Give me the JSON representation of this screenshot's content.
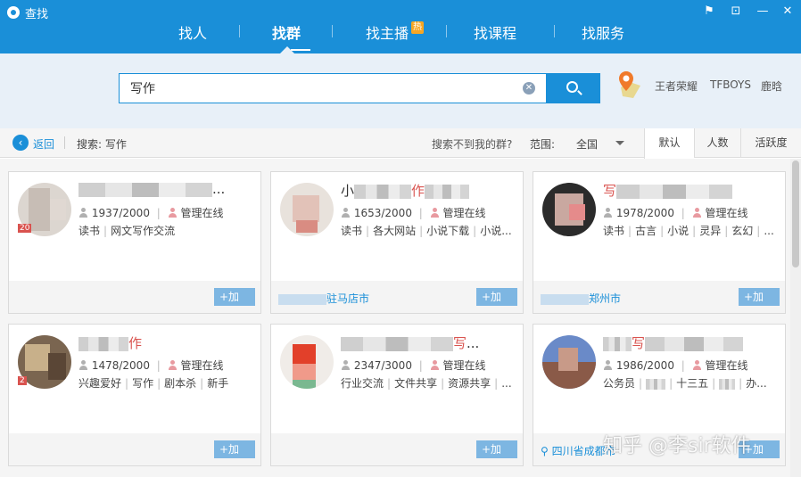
{
  "window": {
    "title": "查找",
    "controls": [
      "⚑",
      "⊡",
      "—",
      "✕"
    ]
  },
  "nav": {
    "tabs": [
      {
        "label": "找人"
      },
      {
        "label": "找群"
      },
      {
        "label": "找主播",
        "badge": "热"
      },
      {
        "label": "找课程"
      },
      {
        "label": "找服务"
      }
    ],
    "active_index": 1
  },
  "search": {
    "value": "写作",
    "placeholder": "",
    "hot_words": [
      "王者荣耀",
      "TFBOYS",
      "鹿晗"
    ]
  },
  "filter": {
    "back_label": "返回",
    "query_label": "搜索: 写作",
    "not_found": "搜索不到我的群?",
    "scope_label": "范围:",
    "scope_value": "全国",
    "sort_tabs": [
      "默认",
      "人数",
      "活跃度"
    ],
    "sort_active": 0
  },
  "results": [
    {
      "title_prefix": "",
      "title_hl": "",
      "title_suffix": "...",
      "members": "1937/2000",
      "admin": "管理在线",
      "tags": [
        "读书",
        "网文写作交流"
      ],
      "location": "",
      "badge": "20",
      "add": "+加"
    },
    {
      "title_prefix": "小",
      "title_hl": "作",
      "title_suffix": "",
      "members": "1653/2000",
      "admin": "管理在线",
      "tags": [
        "读书",
        "各大网站",
        "小说下载",
        "小说..."
      ],
      "location": "驻马店市",
      "badge": "",
      "add": "+加"
    },
    {
      "title_prefix": "",
      "title_hl": "写",
      "title_suffix": "",
      "members": "1978/2000",
      "admin": "管理在线",
      "tags": [
        "读书",
        "古言",
        "小说",
        "灵异",
        "玄幻",
        "..."
      ],
      "location": "郑州市",
      "badge": "",
      "add": "+加"
    },
    {
      "title_prefix": "",
      "title_hl": "作",
      "title_suffix": "",
      "members": "1478/2000",
      "admin": "管理在线",
      "tags": [
        "兴趣爱好",
        "写作",
        "剧本杀",
        "新手"
      ],
      "location": "",
      "badge": "2",
      "add": "+加"
    },
    {
      "title_prefix": "",
      "title_hl": "写",
      "title_suffix": "...",
      "members": "2347/3000",
      "admin": "管理在线",
      "tags": [
        "行业交流",
        "文件共享",
        "资源共享",
        "..."
      ],
      "location": "",
      "badge": "",
      "add": "+加"
    },
    {
      "title_prefix": "",
      "title_hl": "写",
      "title_suffix": "",
      "members": "1986/2000",
      "admin": "管理在线",
      "tags": [
        "公务员",
        "",
        "十三五",
        "",
        "办..."
      ],
      "location": "四川省成都市",
      "badge": "",
      "add": "+加"
    }
  ],
  "watermark": "知乎 @李sir软件",
  "colors": {
    "brand": "#1a8fd8",
    "highlight": "#d9534f",
    "bg_search": "#e8f0f8"
  }
}
